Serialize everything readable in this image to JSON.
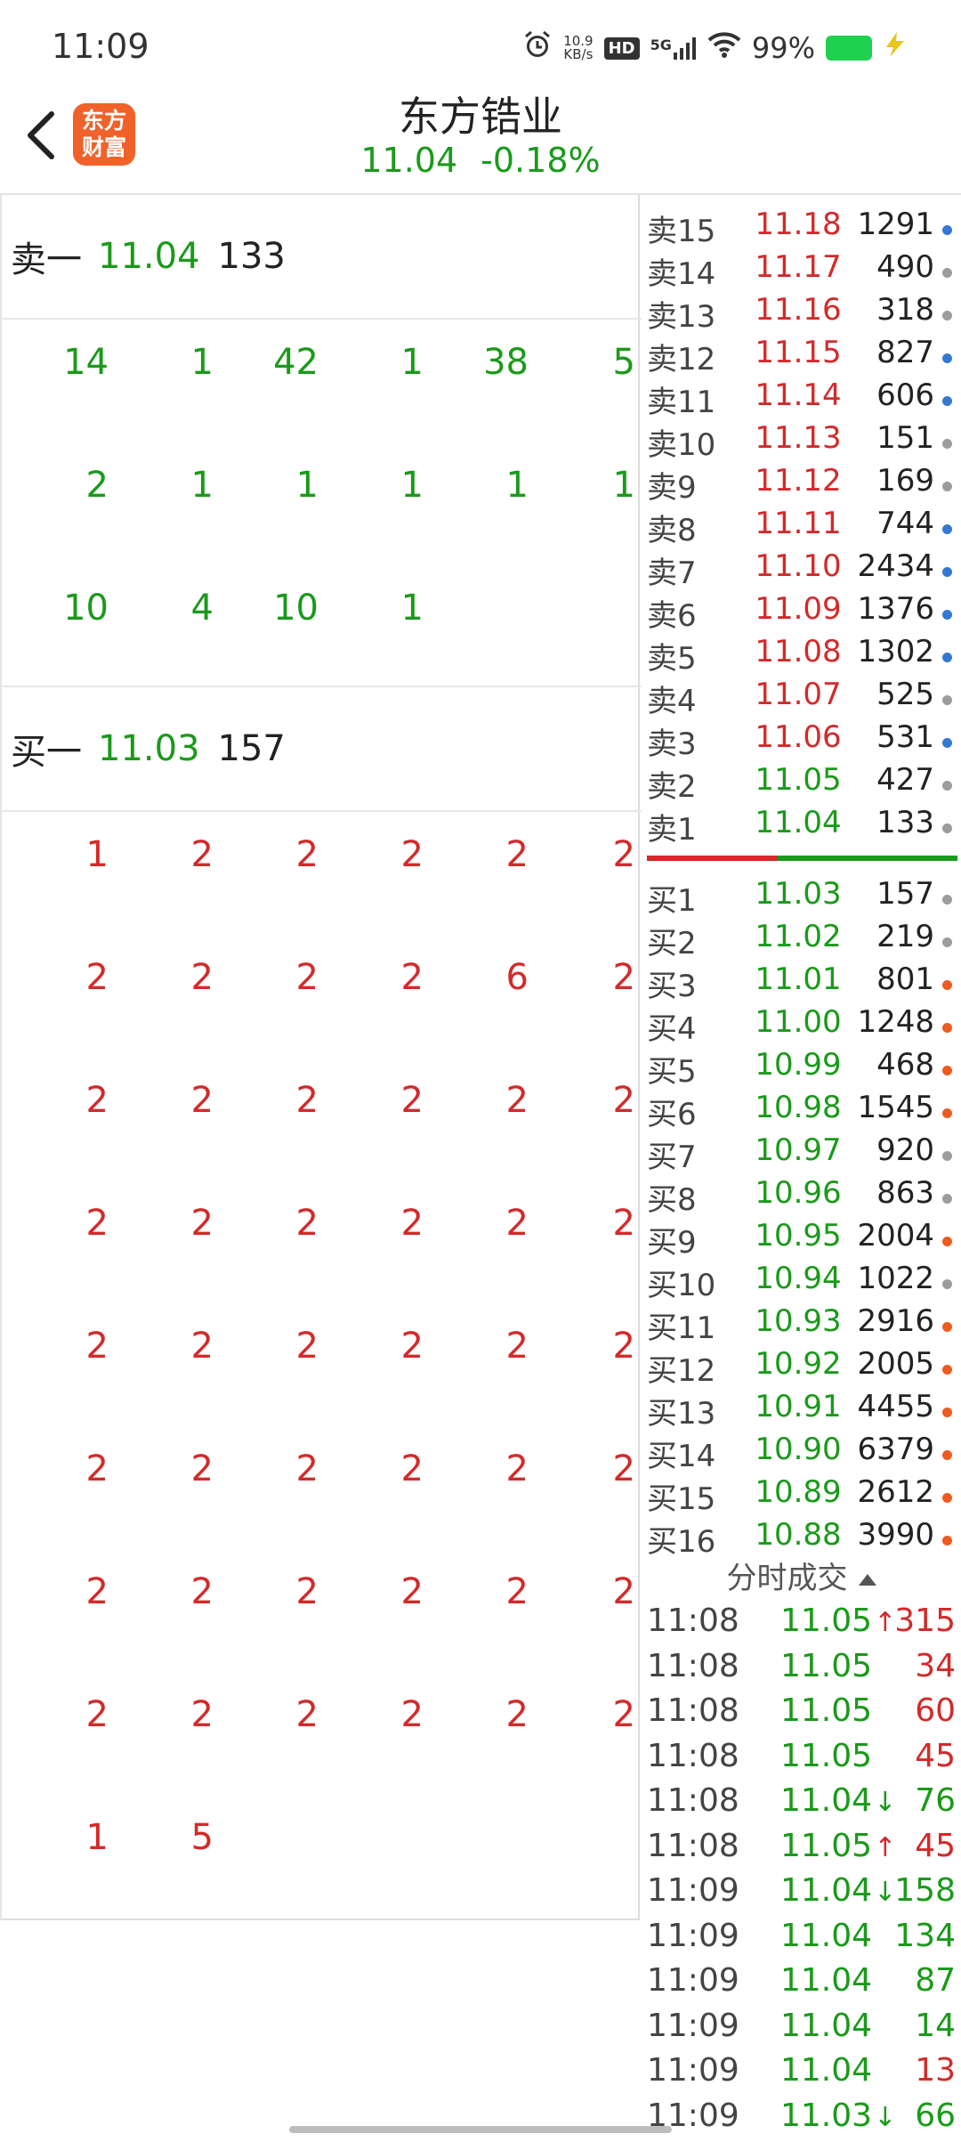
{
  "status_bar": {
    "time": "11:09",
    "net_speed_value": "10.9",
    "net_speed_unit": "KB/s",
    "hd_label": "HD",
    "signal_label": "5G",
    "battery_percent": "99%",
    "battery_color": "#1fd14f"
  },
  "header": {
    "logo_line1": "东方",
    "logo_line2": "财富",
    "logo_color": "#f1612a",
    "stock_name": "东方锆业",
    "price": "11.04",
    "change_percent": "-0.18%"
  },
  "sell1": {
    "label": "卖一",
    "price": "11.04",
    "volume": "133",
    "queue": [
      [
        "14",
        "1",
        "42",
        "1",
        "38",
        "5"
      ],
      [
        "2",
        "1",
        "1",
        "1",
        "1",
        "1"
      ],
      [
        "10",
        "4",
        "10",
        "1"
      ]
    ]
  },
  "buy1": {
    "label": "买一",
    "price": "11.03",
    "volume": "157",
    "queue": [
      [
        "1",
        "2",
        "2",
        "2",
        "2",
        "2"
      ],
      [
        "2",
        "2",
        "2",
        "2",
        "6",
        "2"
      ],
      [
        "2",
        "2",
        "2",
        "2",
        "2",
        "2"
      ],
      [
        "2",
        "2",
        "2",
        "2",
        "2",
        "2"
      ],
      [
        "2",
        "2",
        "2",
        "2",
        "2",
        "2"
      ],
      [
        "2",
        "2",
        "2",
        "2",
        "2",
        "2"
      ],
      [
        "2",
        "2",
        "2",
        "2",
        "2",
        "2"
      ],
      [
        "2",
        "2",
        "2",
        "2",
        "2",
        "2"
      ],
      [
        "1",
        "5"
      ]
    ]
  },
  "order_book": {
    "asks": [
      {
        "label": "卖15",
        "price": "11.18",
        "vol": "1291",
        "dot": "blue"
      },
      {
        "label": "卖14",
        "price": "11.17",
        "vol": "490",
        "dot": "gray"
      },
      {
        "label": "卖13",
        "price": "11.16",
        "vol": "318",
        "dot": "gray"
      },
      {
        "label": "卖12",
        "price": "11.15",
        "vol": "827",
        "dot": "blue"
      },
      {
        "label": "卖11",
        "price": "11.14",
        "vol": "606",
        "dot": "blue"
      },
      {
        "label": "卖10",
        "price": "11.13",
        "vol": "151",
        "dot": "gray"
      },
      {
        "label": "卖9",
        "price": "11.12",
        "vol": "169",
        "dot": "gray"
      },
      {
        "label": "卖8",
        "price": "11.11",
        "vol": "744",
        "dot": "blue"
      },
      {
        "label": "卖7",
        "price": "11.10",
        "vol": "2434",
        "dot": "blue"
      },
      {
        "label": "卖6",
        "price": "11.09",
        "vol": "1376",
        "dot": "blue"
      },
      {
        "label": "卖5",
        "price": "11.08",
        "vol": "1302",
        "dot": "blue"
      },
      {
        "label": "卖4",
        "price": "11.07",
        "vol": "525",
        "dot": "gray"
      },
      {
        "label": "卖3",
        "price": "11.06",
        "vol": "531",
        "dot": "blue"
      },
      {
        "label": "卖2",
        "price": "11.05",
        "vol": "427",
        "dot": "gray"
      },
      {
        "label": "卖1",
        "price": "11.04",
        "vol": "133",
        "dot": "gray"
      }
    ],
    "bids": [
      {
        "label": "买1",
        "price": "11.03",
        "vol": "157",
        "dot": "gray"
      },
      {
        "label": "买2",
        "price": "11.02",
        "vol": "219",
        "dot": "gray"
      },
      {
        "label": "买3",
        "price": "11.01",
        "vol": "801",
        "dot": "orange"
      },
      {
        "label": "买4",
        "price": "11.00",
        "vol": "1248",
        "dot": "orange"
      },
      {
        "label": "买5",
        "price": "10.99",
        "vol": "468",
        "dot": "orange"
      },
      {
        "label": "买6",
        "price": "10.98",
        "vol": "1545",
        "dot": "orange"
      },
      {
        "label": "买7",
        "price": "10.97",
        "vol": "920",
        "dot": "gray"
      },
      {
        "label": "买8",
        "price": "10.96",
        "vol": "863",
        "dot": "gray"
      },
      {
        "label": "买9",
        "price": "10.95",
        "vol": "2004",
        "dot": "orange"
      },
      {
        "label": "买10",
        "price": "10.94",
        "vol": "1022",
        "dot": "gray"
      },
      {
        "label": "买11",
        "price": "10.93",
        "vol": "2916",
        "dot": "orange"
      },
      {
        "label": "买12",
        "price": "10.92",
        "vol": "2005",
        "dot": "orange"
      },
      {
        "label": "买13",
        "price": "10.91",
        "vol": "4455",
        "dot": "orange"
      },
      {
        "label": "买14",
        "price": "10.90",
        "vol": "6379",
        "dot": "orange"
      },
      {
        "label": "买15",
        "price": "10.89",
        "vol": "2612",
        "dot": "orange"
      },
      {
        "label": "买16",
        "price": "10.88",
        "vol": "3990",
        "dot": "orange"
      }
    ],
    "sell_buy_ratio": 0.42
  },
  "ticks": {
    "title": "分时成交",
    "rows": [
      {
        "time": "11:08",
        "price": "11.05",
        "arrow": "up",
        "vol": "315",
        "vol_color": "red"
      },
      {
        "time": "11:08",
        "price": "11.05",
        "arrow": "",
        "vol": "34",
        "vol_color": "red"
      },
      {
        "time": "11:08",
        "price": "11.05",
        "arrow": "",
        "vol": "60",
        "vol_color": "red"
      },
      {
        "time": "11:08",
        "price": "11.05",
        "arrow": "",
        "vol": "45",
        "vol_color": "red"
      },
      {
        "time": "11:08",
        "price": "11.04",
        "arrow": "down",
        "vol": "76",
        "vol_color": "green"
      },
      {
        "time": "11:08",
        "price": "11.05",
        "arrow": "up",
        "vol": "45",
        "vol_color": "red"
      },
      {
        "time": "11:09",
        "price": "11.04",
        "arrow": "down",
        "vol": "158",
        "vol_color": "green"
      },
      {
        "time": "11:09",
        "price": "11.04",
        "arrow": "",
        "vol": "134",
        "vol_color": "green"
      },
      {
        "time": "11:09",
        "price": "11.04",
        "arrow": "",
        "vol": "87",
        "vol_color": "green"
      },
      {
        "time": "11:09",
        "price": "11.04",
        "arrow": "",
        "vol": "14",
        "vol_color": "green"
      },
      {
        "time": "11:09",
        "price": "11.04",
        "arrow": "",
        "vol": "13",
        "vol_color": "red"
      },
      {
        "time": "11:09",
        "price": "11.03",
        "arrow": "down",
        "vol": "66",
        "vol_color": "green"
      }
    ]
  },
  "colors": {
    "up_red": "#d32a2a",
    "down_green": "#1a9a1a"
  }
}
